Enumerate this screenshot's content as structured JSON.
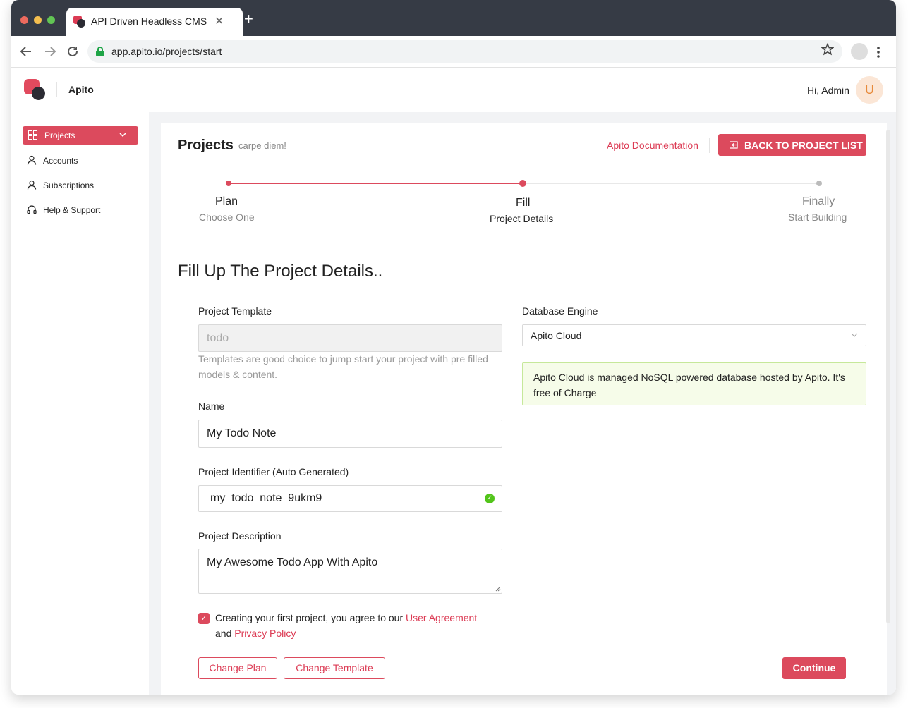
{
  "browser": {
    "tab_title": "API Driven Headless CMS",
    "tab_close": "✕",
    "new_tab": "+",
    "url": "app.apito.io/projects/start",
    "traffic_colors": [
      "#ed6a5e",
      "#f5bf4f",
      "#62c554"
    ]
  },
  "header": {
    "app_name": "Apito",
    "greeting": "Hi, Admin",
    "avatar_initial": "U"
  },
  "sidebar": {
    "items": [
      {
        "label": "Projects",
        "icon": "grid-icon",
        "active": true
      },
      {
        "label": "Accounts",
        "icon": "user-icon"
      },
      {
        "label": "Subscriptions",
        "icon": "user-icon"
      },
      {
        "label": "Help & Support",
        "icon": "headset-icon"
      }
    ]
  },
  "page": {
    "title": "Projects",
    "subtitle": "carpe diem!",
    "doc_link": "Apito Documentation",
    "back_button": "BACK TO PROJECT LIST"
  },
  "steps": [
    {
      "title": "Plan",
      "desc": "Choose One",
      "state": "done"
    },
    {
      "title": "Fill",
      "desc": "Project Details",
      "state": "current"
    },
    {
      "title": "Finally",
      "desc": "Start Building",
      "state": "pending"
    }
  ],
  "form": {
    "section_title": "Fill Up The Project Details..",
    "template_label": "Project Template",
    "template_value": "todo",
    "template_help": "Templates are good choice to jump start your project with pre filled models & content.",
    "name_label": "Name",
    "name_value": "My Todo Note",
    "identifier_label": "Project Identifier (Auto Generated)",
    "identifier_value": "my_todo_note_9ukm9",
    "description_label": "Project Description",
    "description_value": "My Awesome Todo App With Apito",
    "db_label": "Database Engine",
    "db_value": "Apito Cloud",
    "db_info": "Apito Cloud is managed NoSQL powered database hosted by Apito. It's free of Charge",
    "agree_text": "Creating your first project, you agree to our",
    "agree_link1": "User Agreement",
    "agree_and": "and",
    "agree_link2": "Privacy Policy",
    "agree_checked": true
  },
  "actions": {
    "change_plan": "Change Plan",
    "change_template": "Change Template",
    "continue": "Continue"
  },
  "colors": {
    "accent": "#dc4a5d",
    "success": "#52c41a",
    "info_bg": "#f6fce9"
  }
}
